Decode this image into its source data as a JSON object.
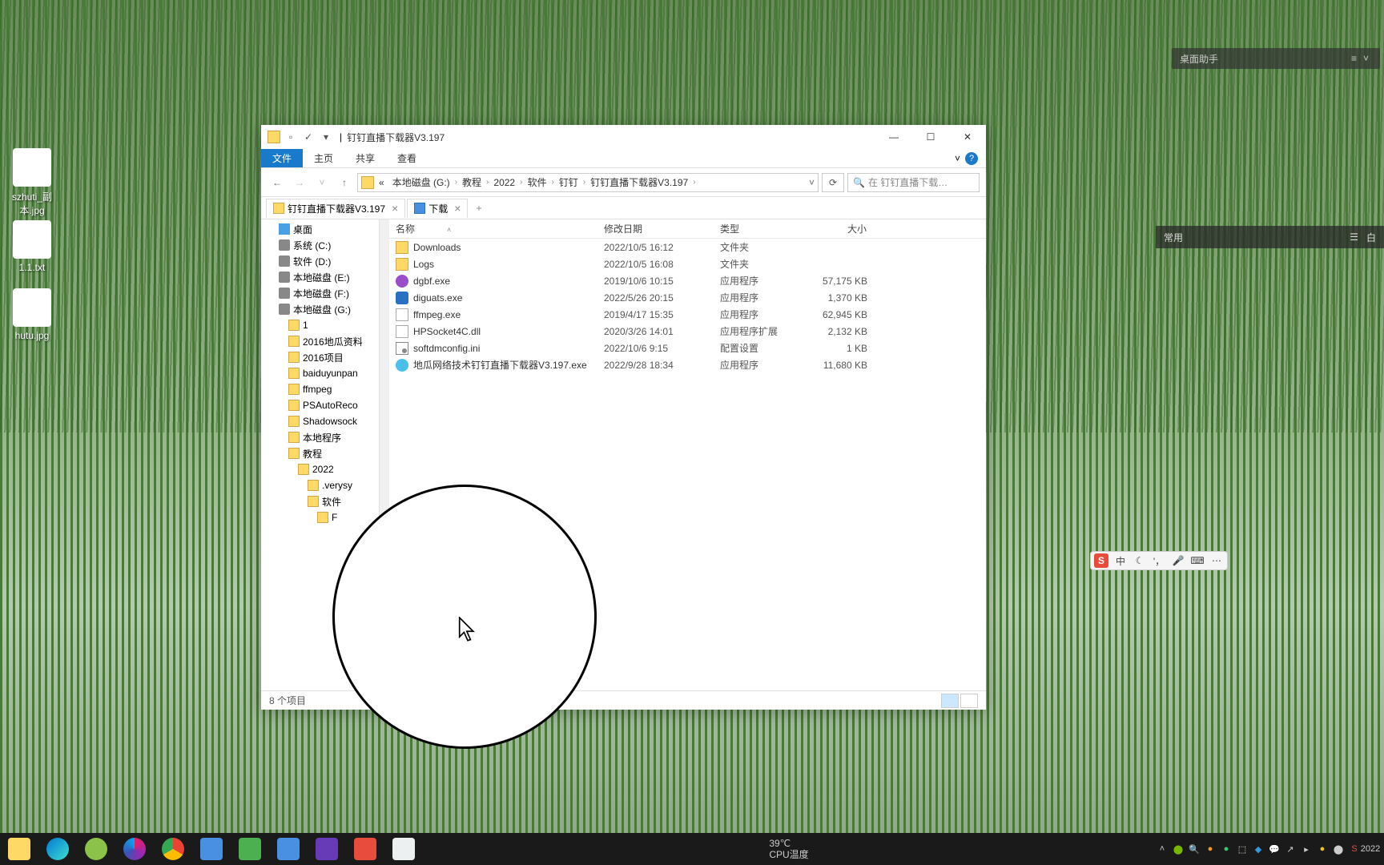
{
  "desktop": {
    "icons": [
      "szhuti_副本.jpg",
      "1.1.txt",
      "hutu.jpg"
    ]
  },
  "assistant": {
    "title": "桌面助手"
  },
  "sidebar_right": {
    "label": "常用"
  },
  "explorer": {
    "title": "钉钉直播下载器V3.197",
    "ribbon": {
      "file": "文件",
      "home": "主页",
      "share": "共享",
      "view": "查看"
    },
    "breadcrumbs": [
      "«",
      "本地磁盘 (G:)",
      "教程",
      "2022",
      "软件",
      "钉钉",
      "钉钉直播下载器V3.197"
    ],
    "search_placeholder": "在 钉钉直播下载…",
    "tabs": [
      {
        "label": "钉钉直播下载器V3.197"
      },
      {
        "label": "下载"
      }
    ],
    "tree": [
      {
        "label": "桌面",
        "icon": "desktop-ic",
        "indent": 12
      },
      {
        "label": "系统 (C:)",
        "icon": "drive",
        "indent": 12
      },
      {
        "label": "软件 (D:)",
        "icon": "drive",
        "indent": 12
      },
      {
        "label": "本地磁盘 (E:)",
        "icon": "drive",
        "indent": 12
      },
      {
        "label": "本地磁盘 (F:)",
        "icon": "drive",
        "indent": 12
      },
      {
        "label": "本地磁盘 (G:)",
        "icon": "drive",
        "indent": 12
      },
      {
        "label": "1",
        "icon": "folder",
        "indent": 24
      },
      {
        "label": "2016地瓜资料",
        "icon": "folder",
        "indent": 24
      },
      {
        "label": "2016项目",
        "icon": "folder",
        "indent": 24
      },
      {
        "label": "baiduyunpan",
        "icon": "folder",
        "indent": 24
      },
      {
        "label": "ffmpeg",
        "icon": "folder",
        "indent": 24
      },
      {
        "label": "PSAutoReco",
        "icon": "folder",
        "indent": 24
      },
      {
        "label": "Shadowsock",
        "icon": "folder",
        "indent": 24
      },
      {
        "label": "本地程序",
        "icon": "folder",
        "indent": 24
      },
      {
        "label": "教程",
        "icon": "folder",
        "indent": 24
      },
      {
        "label": "2022",
        "icon": "folder",
        "indent": 36
      },
      {
        "label": ".verysy",
        "icon": "folder",
        "indent": 48
      },
      {
        "label": "软件",
        "icon": "folder",
        "indent": 48
      },
      {
        "label": "F",
        "icon": "folder",
        "indent": 60
      }
    ],
    "columns": {
      "name": "名称",
      "date": "修改日期",
      "type": "类型",
      "size": "大小"
    },
    "files": [
      {
        "icon": "fold",
        "name": "Downloads",
        "date": "2022/10/5 16:12",
        "type": "文件夹",
        "size": ""
      },
      {
        "icon": "fold",
        "name": "Logs",
        "date": "2022/10/5 16:08",
        "type": "文件夹",
        "size": ""
      },
      {
        "icon": "exe-p",
        "name": "dgbf.exe",
        "date": "2019/10/6 10:15",
        "type": "应用程序",
        "size": "57,175 KB"
      },
      {
        "icon": "exe-n",
        "name": "diguats.exe",
        "date": "2022/5/26 20:15",
        "type": "应用程序",
        "size": "1,370 KB"
      },
      {
        "icon": "exe",
        "name": "ffmpeg.exe",
        "date": "2019/4/17 15:35",
        "type": "应用程序",
        "size": "62,945 KB"
      },
      {
        "icon": "dll",
        "name": "HPSocket4C.dll",
        "date": "2020/3/26 14:01",
        "type": "应用程序扩展",
        "size": "2,132 KB"
      },
      {
        "icon": "ini",
        "name": "softdmconfig.ini",
        "date": "2022/10/6 9:15",
        "type": "配置设置",
        "size": "1 KB"
      },
      {
        "icon": "exe-g",
        "name": "地瓜网络技术钉钉直播下载器V3.197.exe",
        "date": "2022/9/28 18:34",
        "type": "应用程序",
        "size": "11,680 KB"
      }
    ],
    "status": "8 个项目"
  },
  "ime": {
    "lang": "中"
  },
  "taskbar": {
    "temp_line1": "39℃",
    "temp_line2": "CPU温度"
  }
}
